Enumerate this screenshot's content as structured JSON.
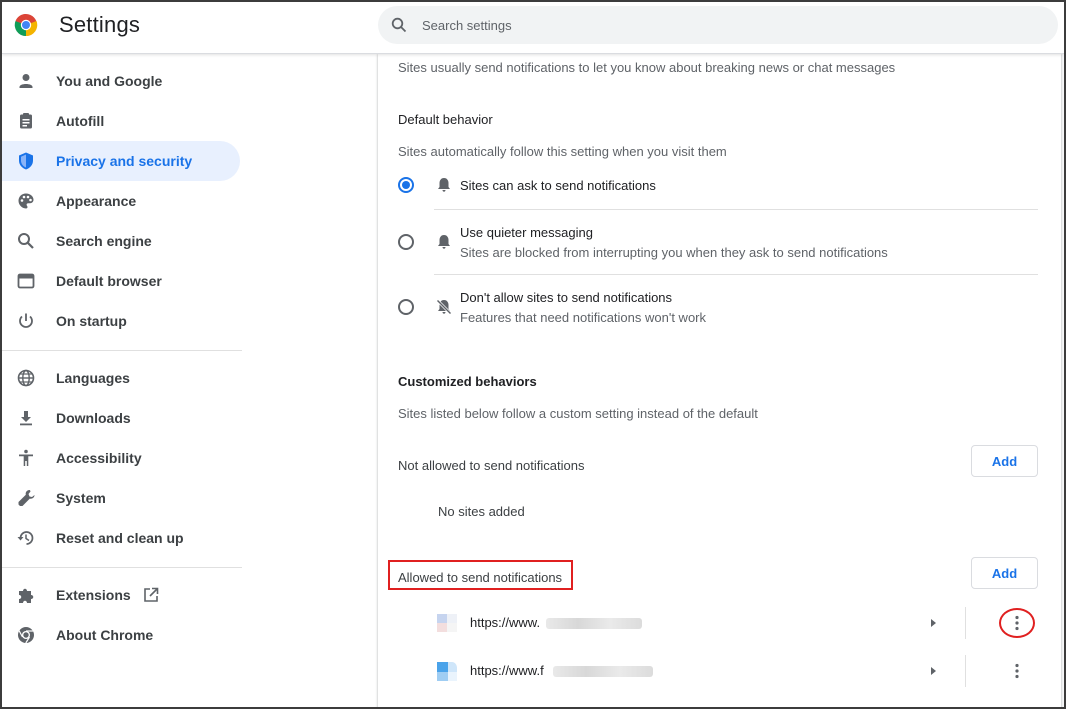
{
  "header": {
    "title": "Settings",
    "search_placeholder": "Search settings"
  },
  "sidebar": {
    "items": [
      {
        "label": "You and Google",
        "icon": "person-icon"
      },
      {
        "label": "Autofill",
        "icon": "clipboard-icon"
      },
      {
        "label": "Privacy and security",
        "icon": "shield-icon",
        "active": true
      },
      {
        "label": "Appearance",
        "icon": "palette-icon"
      },
      {
        "label": "Search engine",
        "icon": "search-icon"
      },
      {
        "label": "Default browser",
        "icon": "browser-window-icon"
      },
      {
        "label": "On startup",
        "icon": "power-icon"
      },
      {
        "label": "Languages",
        "icon": "globe-icon"
      },
      {
        "label": "Downloads",
        "icon": "download-icon"
      },
      {
        "label": "Accessibility",
        "icon": "accessibility-icon"
      },
      {
        "label": "System",
        "icon": "wrench-icon"
      },
      {
        "label": "Reset and clean up",
        "icon": "restore-icon"
      },
      {
        "label": "Extensions",
        "icon": "puzzle-icon"
      },
      {
        "label": "About Chrome",
        "icon": "chrome-icon"
      }
    ]
  },
  "main": {
    "intro": "Sites usually send notifications to let you know about breaking news or chat messages",
    "default_behavior": {
      "heading": "Default behavior",
      "description": "Sites automatically follow this setting when you visit them",
      "options": [
        {
          "label": "Sites can ask to send notifications",
          "sub": "",
          "checked": true,
          "icon": "bell-icon"
        },
        {
          "label": "Use quieter messaging",
          "sub": "Sites are blocked from interrupting you when they ask to send notifications",
          "checked": false,
          "icon": "bell-icon"
        },
        {
          "label": "Don't allow sites to send notifications",
          "sub": "Features that need notifications won't work",
          "checked": false,
          "icon": "bell-off-icon"
        }
      ]
    },
    "customized": {
      "heading": "Customized behaviors",
      "description": "Sites listed below follow a custom setting instead of the default",
      "not_allowed": {
        "label": "Not allowed to send notifications",
        "add_label": "Add",
        "empty_text": "No sites added"
      },
      "allowed": {
        "label": "Allowed to send notifications",
        "add_label": "Add",
        "sites": [
          {
            "url": "https://www."
          },
          {
            "url": "https://www.f"
          }
        ]
      }
    }
  },
  "colors": {
    "accent": "#1a73e8",
    "highlight": "#e02020",
    "active_bg": "#e8f0fe"
  }
}
